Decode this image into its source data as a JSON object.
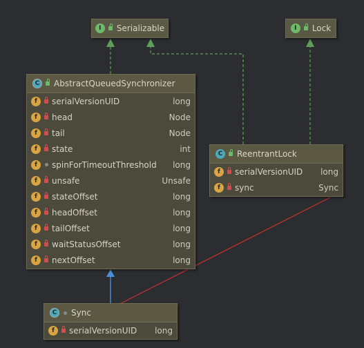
{
  "interfaces": {
    "serializable": {
      "name": "Serializable",
      "badge": "I"
    },
    "lock": {
      "name": "Lock",
      "badge": "I"
    }
  },
  "aqs": {
    "name": "AbstractQueuedSynchronizer",
    "badge": "C",
    "fields": [
      {
        "name": "serialVersionUID",
        "type": "long"
      },
      {
        "name": "head",
        "type": "Node"
      },
      {
        "name": "tail",
        "type": "Node"
      },
      {
        "name": "state",
        "type": "int"
      },
      {
        "name": "spinForTimeoutThreshold",
        "type": "long"
      },
      {
        "name": "unsafe",
        "type": "Unsafe"
      },
      {
        "name": "stateOffset",
        "type": "long"
      },
      {
        "name": "headOffset",
        "type": "long"
      },
      {
        "name": "tailOffset",
        "type": "long"
      },
      {
        "name": "waitStatusOffset",
        "type": "long"
      },
      {
        "name": "nextOffset",
        "type": "long"
      }
    ]
  },
  "reentrant_lock": {
    "name": "ReentrantLock",
    "badge": "C",
    "fields": [
      {
        "name": "serialVersionUID",
        "type": "long"
      },
      {
        "name": "sync",
        "type": "Sync"
      }
    ]
  },
  "sync": {
    "name": "Sync",
    "badge": "C",
    "fields": [
      {
        "name": "serialVersionUID",
        "type": "long"
      }
    ]
  },
  "field_badge": "f",
  "colors": {
    "background": "#2b2d30",
    "implements_edge": "#5f9e58",
    "extends_edge": "#4b8fd6",
    "association_edge": "#c83232"
  }
}
